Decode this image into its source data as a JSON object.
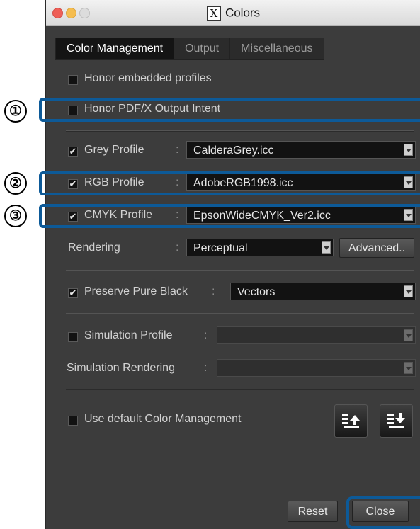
{
  "window": {
    "title": "Colors",
    "app_icon_glyph": "X"
  },
  "tabs": [
    {
      "label": "Color Management",
      "active": true
    },
    {
      "label": "Output",
      "active": false
    },
    {
      "label": "Miscellaneous",
      "active": false
    }
  ],
  "options": {
    "honor_embedded": {
      "label": "Honor embedded profiles",
      "checked": false
    },
    "honor_pdfx": {
      "label": "Honor PDF/X Output Intent",
      "checked": false
    }
  },
  "profiles": {
    "grey": {
      "label": "Grey Profile",
      "checked": true,
      "value": "CalderaGrey.icc"
    },
    "rgb": {
      "label": "RGB Profile",
      "checked": true,
      "value": "AdobeRGB1998.icc"
    },
    "cmyk": {
      "label": "CMYK Profile",
      "checked": true,
      "value": "EpsonWideCMYK_Ver2.icc"
    },
    "separator": ":"
  },
  "rendering": {
    "label": "Rendering",
    "value": "Perceptual",
    "advanced_label": "Advanced.."
  },
  "preserve_black": {
    "label": "Preserve Pure Black",
    "checked": true,
    "value": "Vectors"
  },
  "simulation": {
    "profile_label": "Simulation Profile",
    "profile_checked": false,
    "rendering_label": "Simulation Rendering"
  },
  "default_cm": {
    "label": "Use default Color Management",
    "checked": false
  },
  "footer": {
    "reset_label": "Reset",
    "close_label": "Close"
  },
  "callouts": [
    "①",
    "②",
    "③"
  ],
  "checkmark": "✔",
  "colors": {
    "callout": "#0d5a98",
    "panel": "#3c3c3c",
    "field": "#121212"
  }
}
